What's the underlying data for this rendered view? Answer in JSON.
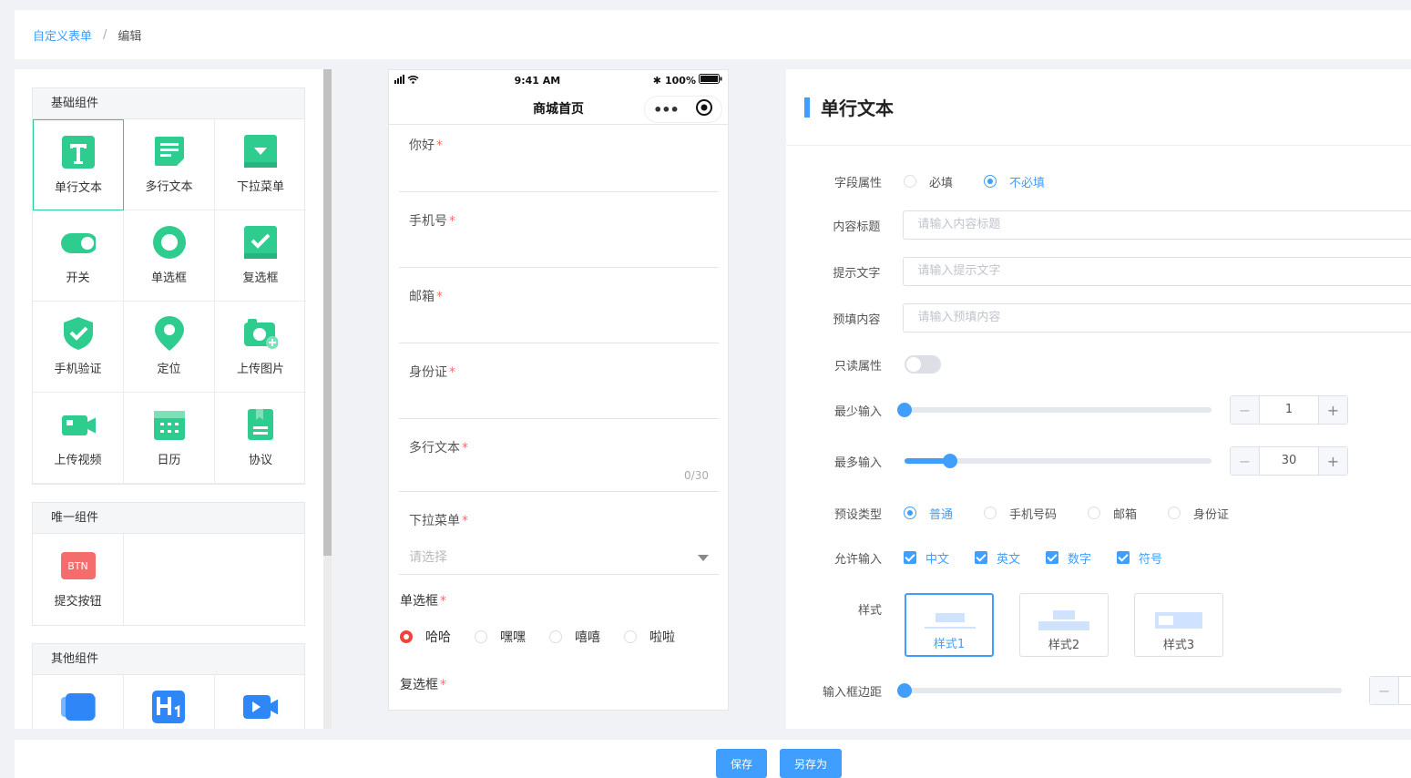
{
  "breadcrumb": {
    "root": "自定义表单",
    "separator": "/",
    "current": "编辑"
  },
  "components": {
    "basic": {
      "title": "基础组件",
      "items": [
        {
          "label": "单行文本",
          "icon": "text-t-icon"
        },
        {
          "label": "多行文本",
          "icon": "multiline-text-icon"
        },
        {
          "label": "下拉菜单",
          "icon": "dropdown-icon"
        },
        {
          "label": "开关",
          "icon": "toggle-icon"
        },
        {
          "label": "单选框",
          "icon": "radio-icon"
        },
        {
          "label": "复选框",
          "icon": "checkbox-icon"
        },
        {
          "label": "手机验证",
          "icon": "shield-check-icon"
        },
        {
          "label": "定位",
          "icon": "location-pin-icon"
        },
        {
          "label": "上传图片",
          "icon": "camera-icon"
        },
        {
          "label": "上传视频",
          "icon": "video-icon"
        },
        {
          "label": "日历",
          "icon": "calendar-icon"
        },
        {
          "label": "协议",
          "icon": "document-icon"
        }
      ]
    },
    "unique": {
      "title": "唯一组件",
      "items": [
        {
          "label": "提交按钮",
          "icon": "submit-button-icon",
          "badge": "BTN"
        }
      ]
    },
    "other": {
      "title": "其他组件",
      "items": [
        {
          "label": "",
          "icon": "banner-icon"
        },
        {
          "label": "",
          "icon": "heading-h1-icon"
        },
        {
          "label": "",
          "icon": "video-camera-icon"
        }
      ]
    }
  },
  "phone": {
    "time": "9:41 AM",
    "battery": "100%",
    "title": "商城首页",
    "fields": [
      {
        "label": "你好",
        "required": "*"
      },
      {
        "label": "手机号",
        "required": "*"
      },
      {
        "label": "邮箱",
        "required": "*"
      },
      {
        "label": "身份证",
        "required": "*"
      },
      {
        "label": "多行文本",
        "required": "*",
        "counter": "0/30"
      },
      {
        "label": "下拉菜单",
        "required": "*",
        "placeholder": "请选择"
      }
    ],
    "radio": {
      "label": "单选框",
      "required": "*",
      "options": [
        "哈哈",
        "嘿嘿",
        "嘻嘻",
        "啦啦"
      ]
    },
    "checkbox": {
      "label": "复选框",
      "required": "*"
    }
  },
  "props": {
    "title": "单行文本",
    "field_attr": {
      "label": "字段属性",
      "options": [
        "必填",
        "不必填"
      ],
      "selected": "不必填"
    },
    "content_title": {
      "label": "内容标题",
      "placeholder": "请输入内容标题"
    },
    "hint_text": {
      "label": "提示文字",
      "placeholder": "请输入提示文字"
    },
    "prefill": {
      "label": "预填内容",
      "placeholder": "请输入预填内容"
    },
    "readonly": {
      "label": "只读属性",
      "on": false
    },
    "min_input": {
      "label": "最少输入",
      "value": "1",
      "fraction": 0
    },
    "max_input": {
      "label": "最多输入",
      "value": "30",
      "fraction": 0.147
    },
    "preset": {
      "label": "预设类型",
      "options": [
        "普通",
        "手机号码",
        "邮箱",
        "身份证"
      ],
      "selected": "普通"
    },
    "allowed": {
      "label": "允许输入",
      "options": [
        "中文",
        "英文",
        "数字",
        "符号"
      ]
    },
    "style": {
      "label": "样式",
      "options": [
        "样式1",
        "样式2",
        "样式3"
      ],
      "selected": "样式1"
    },
    "margin": {
      "label": "输入框边距",
      "fraction": 0
    }
  },
  "footer": {
    "save": "保存",
    "save_as": "另存为"
  },
  "colors": {
    "accent": "#409eff",
    "icon_green": "#2ecc8f",
    "required": "#f56c6c",
    "radio_red": "#f0443a"
  }
}
